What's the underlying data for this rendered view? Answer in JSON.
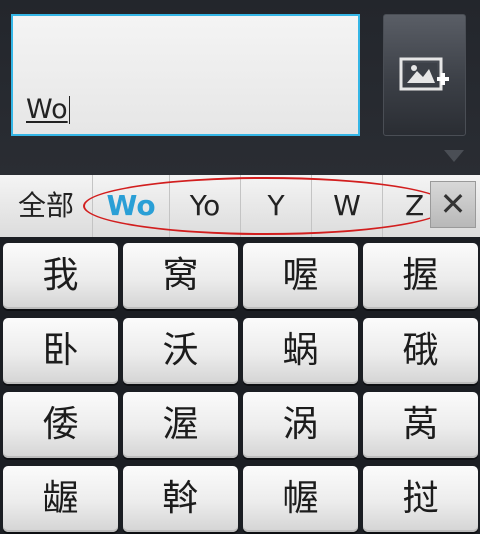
{
  "compose": {
    "text": "Wo"
  },
  "attach": {
    "icon": "add-image-icon"
  },
  "candidates": {
    "all_label": "全部",
    "items": [
      "Wo",
      "Yo",
      "Y",
      "W",
      "Z"
    ],
    "selected": "Wo",
    "close_label": "✕"
  },
  "keys": [
    [
      "我",
      "窝",
      "喔",
      "握"
    ],
    [
      "卧",
      "沃",
      "蜗",
      "硪"
    ],
    [
      "倭",
      "渥",
      "涡",
      "莴"
    ],
    [
      "龌",
      "斡",
      "幄",
      "挝"
    ]
  ],
  "colors": {
    "accent": "#35b6e6",
    "selected_text": "#2a9fd6",
    "highlight_ellipse": "#d21e1e"
  }
}
